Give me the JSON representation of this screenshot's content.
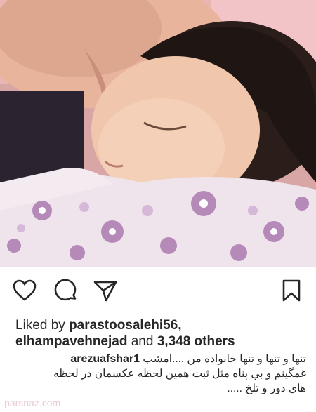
{
  "post": {
    "image_alt": "Adult resting face against sleeping toddler wrapped in floral pink blanket",
    "actions": {
      "like_icon": "heart-icon",
      "comment_icon": "comment-bubble-icon",
      "share_icon": "paper-plane-icon",
      "save_icon": "bookmark-icon"
    },
    "likes": {
      "prefix": "Liked by",
      "user1": "parastoosalehi56,",
      "user2": "elhampavehnejad",
      "connector": "and",
      "others": "3,348 others"
    },
    "caption": {
      "username": "arezuafshar1",
      "line1": "تنها و تنها و تنها خانواده من ....امشب",
      "line2": "غمگینم و بي پناه مثل ثبت همین لحظه عکسمان در لحظه",
      "line3": "هاي دور و تلخ ....."
    },
    "watermark": "parsnaz.com"
  },
  "colors": {
    "text": "#262626",
    "blanket": "#efe3ec",
    "flower": "#b58ab8",
    "hair": "#2a1d1a",
    "skin": "#f0c7ad"
  }
}
